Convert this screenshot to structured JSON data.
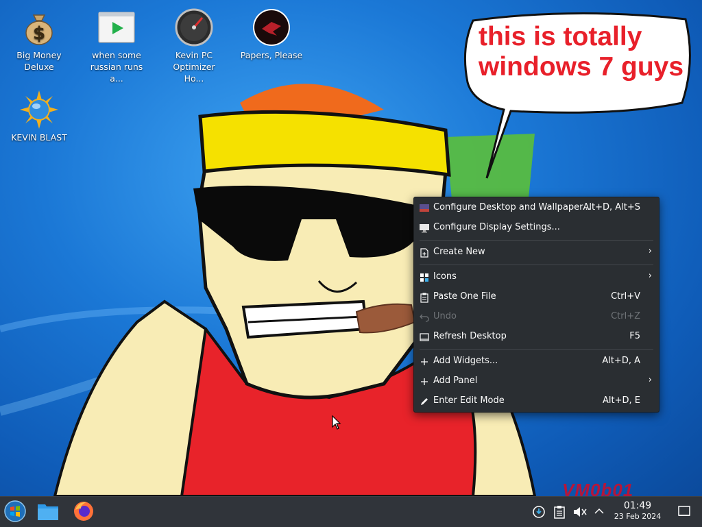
{
  "desktop": {
    "icons": [
      {
        "label": "Big Money Deluxe",
        "icon": "money-bag-icon"
      },
      {
        "label": "when some russian runs a...",
        "icon": "video-player-icon"
      },
      {
        "label": "Kevin PC Optimizer Ho...",
        "icon": "speedometer-icon"
      },
      {
        "label": "Papers, Please",
        "icon": "eagle-emblem-icon"
      },
      {
        "label": "KEVIN BLAST",
        "icon": "sun-globe-icon"
      }
    ],
    "speech_bubble": "this is totally windows 7 guys",
    "watermark": "VM0b01"
  },
  "context_menu": {
    "items": [
      {
        "label": "Configure Desktop and Wallpaper...",
        "shortcut": "Alt+D, Alt+S",
        "icon": "wallpaper-icon",
        "enabled": true,
        "submenu": false
      },
      {
        "label": "Configure Display Settings...",
        "shortcut": "",
        "icon": "display-icon",
        "enabled": true,
        "submenu": false
      },
      {
        "label": "Create New",
        "shortcut": "",
        "icon": "new-file-icon",
        "enabled": true,
        "submenu": true
      },
      {
        "label": "Icons",
        "shortcut": "",
        "icon": "grid-icon",
        "enabled": true,
        "submenu": true
      },
      {
        "label": "Paste One File",
        "shortcut": "Ctrl+V",
        "icon": "clipboard-icon",
        "enabled": true,
        "submenu": false
      },
      {
        "label": "Undo",
        "shortcut": "Ctrl+Z",
        "icon": "undo-icon",
        "enabled": false,
        "submenu": false
      },
      {
        "label": "Refresh Desktop",
        "shortcut": "F5",
        "icon": "refresh-icon",
        "enabled": true,
        "submenu": false
      },
      {
        "label": "Add Widgets...",
        "shortcut": "Alt+D, A",
        "icon": "plus-icon",
        "enabled": true,
        "submenu": false
      },
      {
        "label": "Add Panel",
        "shortcut": "",
        "icon": "plus-icon",
        "enabled": true,
        "submenu": true
      },
      {
        "label": "Enter Edit Mode",
        "shortcut": "Alt+D, E",
        "icon": "pencil-icon",
        "enabled": true,
        "submenu": false
      }
    ]
  },
  "taskbar": {
    "launchers": [
      {
        "name": "Start Menu",
        "icon": "windows-orb-icon"
      },
      {
        "name": "File Manager",
        "icon": "folder-icon"
      },
      {
        "name": "Firefox",
        "icon": "firefox-icon"
      }
    ],
    "tray": {
      "time": "01:49",
      "date": "23 Feb 2024",
      "volume_state": "muted"
    }
  },
  "colors": {
    "menu_bg": "#2a2e32",
    "taskbar_bg": "#30343a",
    "speech_text": "#e8202a",
    "desktop_blue": "#1b78d6"
  }
}
